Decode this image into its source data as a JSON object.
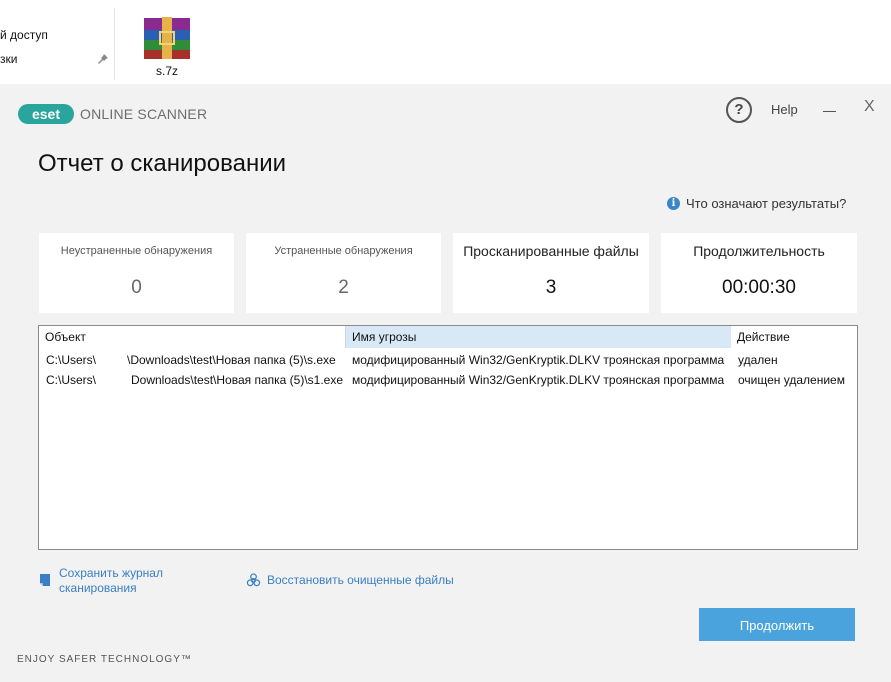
{
  "explorer": {
    "items": [
      "й доступ",
      "зки"
    ],
    "file_label": "s.7z"
  },
  "window": {
    "brand": "eset",
    "product": "ONLINE SCANNER",
    "help_label": "Help",
    "minimize_glyph": "—",
    "close_glyph": "X"
  },
  "report": {
    "title": "Отчет о сканировании",
    "what_mean": "Что означают результаты?",
    "stats": [
      {
        "label": "Неустраненные обнаружения",
        "value": "0"
      },
      {
        "label": "Устраненные обнаружения",
        "value": "2"
      },
      {
        "label": "Просканированные файлы",
        "value": "3"
      },
      {
        "label": "Продолжительность",
        "value": "00:00:30"
      }
    ],
    "columns": [
      "Объект",
      "Имя угрозы",
      "Действие"
    ],
    "rows": [
      {
        "object_user": "C:\\Users\\",
        "object_path": "\\Downloads\\test\\Новая папка (5)\\s.exe",
        "threat": "модифицированный Win32/GenKryptik.DLKV троянская программа",
        "action": "удален"
      },
      {
        "object_user": "C:\\Users\\",
        "object_path": "Downloads\\test\\Новая папка (5)\\s1.exe",
        "threat": "модифицированный Win32/GenKryptik.DLKV троянская программа",
        "action": "очищен удалением"
      }
    ]
  },
  "footer": {
    "save_log": "Сохранить журнал сканирования",
    "save_log_line1": "Сохранить журнал",
    "save_log_line2": "сканирования",
    "restore": "Восстановить очищенные файлы",
    "continue_label": "Продолжить",
    "tagline": "ENJOY SAFER TECHNOLOGY™"
  },
  "colors": {
    "accent": "#4aa3dc",
    "link": "#3a7fc4",
    "brand_teal": "#2aa59e",
    "selected_header": "#d8e8f7"
  },
  "icons": [
    "pin-icon",
    "winrar-archive-icon",
    "help-icon",
    "info-icon",
    "save-document-icon",
    "biohazard-icon"
  ]
}
